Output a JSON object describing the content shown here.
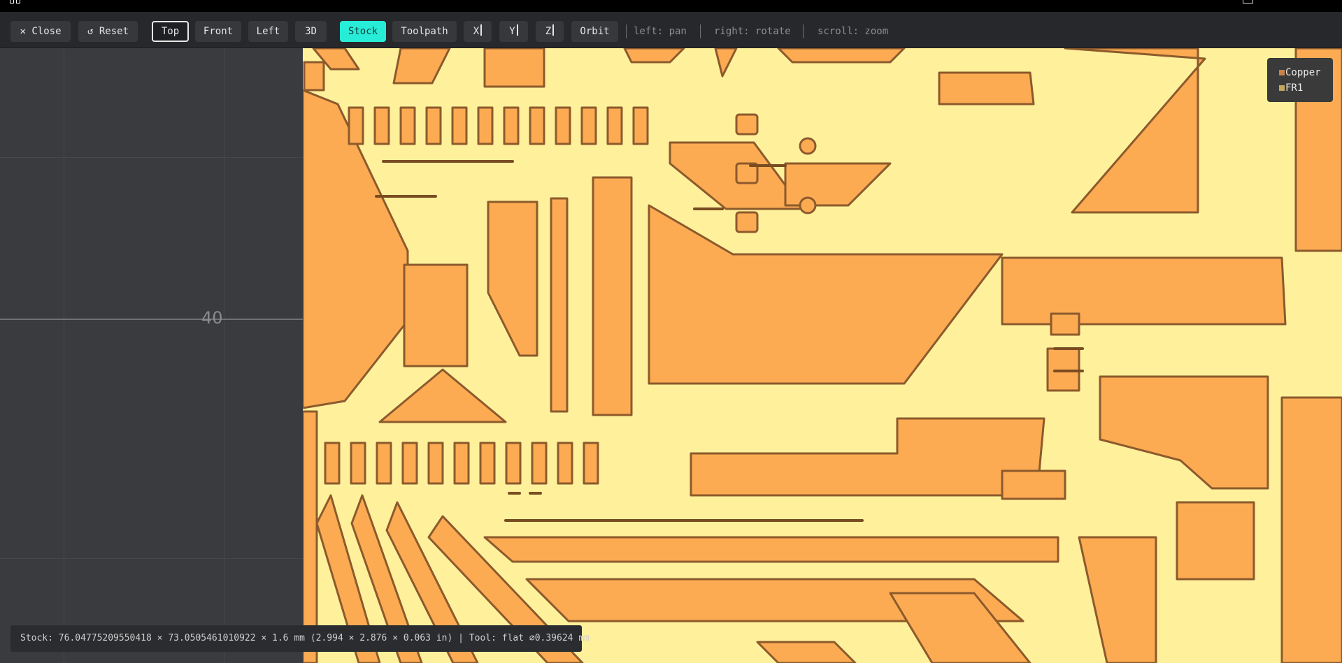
{
  "toolbar": {
    "close": "Close",
    "reset": "Reset",
    "views": [
      "Top",
      "Front",
      "Left",
      "3D"
    ],
    "modes": [
      "Stock",
      "Toolpath"
    ],
    "axes": [
      "X",
      "Y",
      "Z"
    ],
    "orbit": "Orbit",
    "hints": [
      "left: pan",
      "right: rotate",
      "scroll: zoom"
    ],
    "active_view": "Top",
    "active_mode": "Stock"
  },
  "icons": {
    "close": "✕",
    "reset": "↺"
  },
  "viewport": {
    "axis_label": "40"
  },
  "legend": {
    "items": [
      {
        "label": "Copper",
        "color": "#c9834a"
      },
      {
        "label": "FR1",
        "color": "#c7a55e"
      }
    ]
  },
  "status": {
    "text": "Stock: 76.04775209550418 × 73.0505461010922 × 1.6 mm (2.994 × 2.876 × 0.063 in) | Tool: flat ⌀0.39624 mm"
  },
  "colors": {
    "toolbar_bg": "#27282b",
    "accent": "#27ecd8",
    "copper": "#fcab53",
    "fr1": "#fff19c",
    "trace_edge": "#8c5a2c"
  }
}
